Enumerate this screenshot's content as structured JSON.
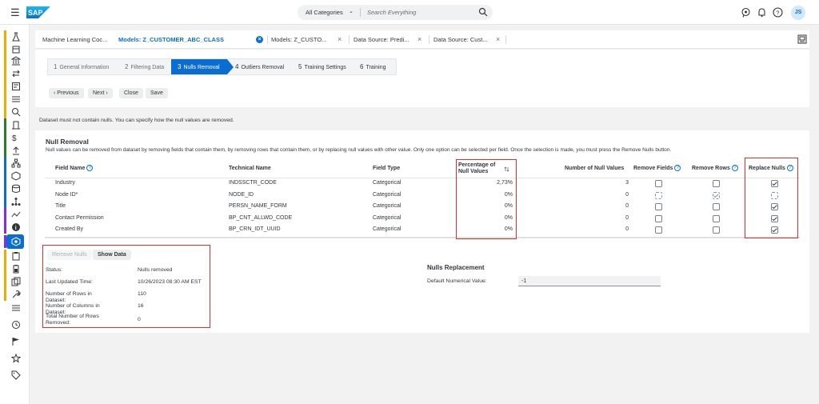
{
  "shell": {
    "search": {
      "category": "All Categories",
      "placeholder": "Search Everything"
    },
    "avatar_initials": "JS",
    "brand_color": "#0a6ed1",
    "header_icons": [
      "assistant-icon",
      "notification-bell-icon",
      "help-icon"
    ]
  },
  "rail": {
    "items": [
      {
        "name": "rail-item-1",
        "icon": "flask-icon",
        "bar": "#f0ab00"
      },
      {
        "name": "rail-item-2",
        "icon": "box-icon",
        "bar": "#f0ab00"
      },
      {
        "name": "rail-item-3",
        "icon": "bank-icon",
        "bar": "#f0ab00"
      },
      {
        "name": "rail-item-4",
        "icon": "transfer-icon",
        "bar": "#f0ab00"
      },
      {
        "name": "rail-item-5",
        "icon": "dashboard-icon",
        "bar": "#f0ab00"
      },
      {
        "name": "rail-item-6",
        "icon": "list-icon",
        "bar": "#f0ab00"
      },
      {
        "name": "rail-item-7",
        "icon": "search-data-icon",
        "bar": "#f0ab00"
      },
      {
        "name": "rail-item-8",
        "icon": "building-icon",
        "bar": "#2b7d2b"
      },
      {
        "name": "rail-item-9",
        "icon": "currency-icon",
        "bar": "#2b7d2b"
      },
      {
        "name": "rail-item-10",
        "icon": "upload-icon",
        "bar": "#2b7d2b"
      },
      {
        "name": "rail-item-11",
        "icon": "hierarchy-icon",
        "bar": "#0a6ed1"
      },
      {
        "name": "rail-item-12",
        "icon": "cube-icon",
        "bar": "#0a6ed1"
      },
      {
        "name": "rail-item-13",
        "icon": "database-icon",
        "bar": "#0a6ed1"
      },
      {
        "name": "rail-item-14",
        "icon": "org-chart-icon",
        "bar": "#0a6ed1"
      },
      {
        "name": "rail-item-15",
        "icon": "trend-icon",
        "bar": "#8a2be2"
      },
      {
        "name": "rail-item-16",
        "icon": "info-icon",
        "bar": "#8a2be2"
      },
      {
        "name": "rail-item-17",
        "icon": "ml-model-icon",
        "bar": "#8a2be2",
        "active": true
      },
      {
        "name": "rail-item-18",
        "icon": "clipboard-icon",
        "bar": "#f0ab00"
      },
      {
        "name": "rail-item-19",
        "icon": "battery-icon",
        "bar": "#f0ab00"
      },
      {
        "name": "rail-item-20",
        "icon": "copy-icon",
        "bar": "#f0ab00"
      },
      {
        "name": "rail-item-21",
        "icon": "wrench-icon",
        "bar": "#f0ab00"
      },
      {
        "name": "rail-item-22",
        "icon": "list-icon",
        "bar": ""
      },
      {
        "name": "rail-item-23",
        "icon": "history-icon",
        "bar": ""
      },
      {
        "name": "rail-item-24",
        "icon": "flag-icon",
        "bar": ""
      },
      {
        "name": "rail-item-25",
        "icon": "favorite-list-icon",
        "bar": ""
      },
      {
        "name": "rail-item-26",
        "icon": "tag-icon",
        "bar": ""
      }
    ]
  },
  "tabs": [
    {
      "label": "Machine Learning Coc...",
      "active": false,
      "closable": false
    },
    {
      "label": "Models: Z_CUSTOMER_ABC_CLASS",
      "active": true,
      "closable": true
    },
    {
      "label": "Models: Z_CUSTO...",
      "active": false,
      "closable": true
    },
    {
      "label": "Data Source: Predi...",
      "active": false,
      "closable": true
    },
    {
      "label": "Data Source: Cust...",
      "active": false,
      "closable": true
    }
  ],
  "wizard": {
    "steps": [
      {
        "num": "1",
        "label": "General Information",
        "state": "inactive"
      },
      {
        "num": "2",
        "label": "Filtering Data",
        "state": "inactive"
      },
      {
        "num": "3",
        "label": "Nulls Removal",
        "state": "active"
      },
      {
        "num": "4",
        "label": "Outliers Removal",
        "state": "upcoming"
      },
      {
        "num": "5",
        "label": "Training Settings",
        "state": "upcoming"
      },
      {
        "num": "6",
        "label": "Training",
        "state": "upcoming"
      }
    ],
    "buttons": {
      "previous": "‹  Previous",
      "next": "Next  ›",
      "close": "Close",
      "save": "Save"
    }
  },
  "info_line": "Dataset must not contain nulls. You can specify how the null values are removed.",
  "nulls_removal": {
    "title": "Null Removal",
    "description": "Null values can be removed from dataset by removing fields that contain them, by removing rows that contain them, or by replacing null values with other value. Only one option can be selected per field. Once the selection is made, you must press the Remove Nulls button.",
    "columns": {
      "field_name": "Field Name",
      "technical_name": "Technical Name",
      "field_type": "Field Type",
      "pct_null_line1": "Percentage of",
      "pct_null_line2": "Null Values",
      "num_null": "Number of Null Values",
      "remove_fields": "Remove Fields",
      "remove_rows": "Remove Rows",
      "replace_nulls": "Replace Nulls"
    },
    "rows": [
      {
        "field_name": "Industry",
        "technical_name": "INDSSCTR_CODE",
        "field_type": "Categorical",
        "pct_null": "2,73%",
        "num_null": "3",
        "remove_fields": false,
        "remove_fields_disabled": false,
        "remove_rows": false,
        "remove_rows_disabled": false,
        "replace_nulls": true,
        "replace_nulls_disabled": false
      },
      {
        "field_name": "Node ID*",
        "technical_name": "NODE_ID",
        "field_type": "Categorical",
        "pct_null": "0%",
        "num_null": "0",
        "remove_fields": false,
        "remove_fields_disabled": true,
        "remove_rows": true,
        "remove_rows_disabled": true,
        "replace_nulls": false,
        "replace_nulls_disabled": true
      },
      {
        "field_name": "Title",
        "technical_name": "PERSN_NAME_FORM",
        "field_type": "Categorical",
        "pct_null": "0%",
        "num_null": "0",
        "remove_fields": false,
        "remove_fields_disabled": false,
        "remove_rows": false,
        "remove_rows_disabled": false,
        "replace_nulls": true,
        "replace_nulls_disabled": false
      },
      {
        "field_name": "Contact Permission",
        "technical_name": "BP_CNT_ALLWD_CODE",
        "field_type": "Categorical",
        "pct_null": "0%",
        "num_null": "0",
        "remove_fields": false,
        "remove_fields_disabled": false,
        "remove_rows": false,
        "remove_rows_disabled": false,
        "replace_nulls": true,
        "replace_nulls_disabled": false
      },
      {
        "field_name": "Created By",
        "technical_name": "BP_CRN_IDT_UUID",
        "field_type": "Categorical",
        "pct_null": "0%",
        "num_null": "0",
        "remove_fields": false,
        "remove_fields_disabled": false,
        "remove_rows": false,
        "remove_rows_disabled": false,
        "replace_nulls": true,
        "replace_nulls_disabled": false
      }
    ]
  },
  "status": {
    "remove_nulls_label": "Remove Nulls",
    "show_data_label": "Show Data",
    "rows": [
      {
        "label": "Status:",
        "value": "Nulls removed"
      },
      {
        "label": "Last Updated Time:",
        "value": "10/26/2023 08:30 AM EST"
      },
      {
        "label": "Number of Rows in Dataset:",
        "value": "110"
      },
      {
        "label": "Number of Columns in Dataset:",
        "value": "16"
      },
      {
        "label": "Total Number of Rows Removed:",
        "value": "0"
      }
    ]
  },
  "nulls_replacement": {
    "title": "Nulls Replacement",
    "label": "Default Numerical Value:",
    "value": "-1"
  },
  "highlight_color": "#d9302b"
}
